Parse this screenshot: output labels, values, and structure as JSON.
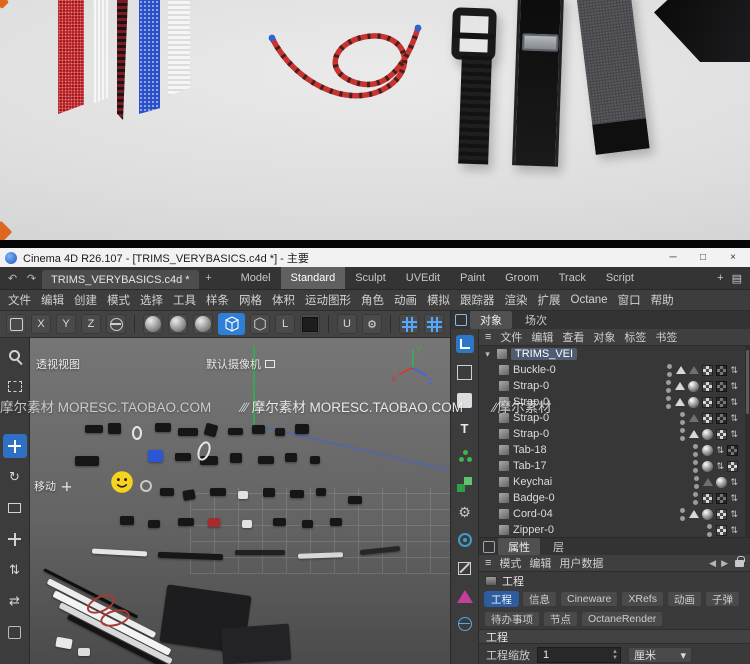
{
  "watermark": {
    "text": "摩尔素材 MORESC.TAOBAO.COM",
    "slashes": "∕∕∕",
    "tail": "∕∕摩尔素材"
  },
  "titlebar": {
    "title": "Cinema 4D R26.107 - [TRIMS_VERYBASICS.c4d *] - 主要",
    "minimize": "─",
    "maximize": "□",
    "close": "×"
  },
  "tabbar": {
    "undo": "↶",
    "redo": "↷",
    "document_tab": "TRIMS_VERYBASICS.c4d *",
    "add_tab": "+",
    "layouts": [
      "Model",
      "Standard",
      "Sculpt",
      "UVEdit",
      "Paint",
      "Groom",
      "Track",
      "Script"
    ],
    "add_layout": "+",
    "layout_menu": "▤"
  },
  "menubar": {
    "items": [
      "文件",
      "编辑",
      "创建",
      "模式",
      "选择",
      "工具",
      "样条",
      "网格",
      "体积",
      "运动图形",
      "角色",
      "动画",
      "模拟",
      "跟踪器",
      "渲染",
      "扩展",
      "Octane",
      "窗口",
      "帮助"
    ]
  },
  "toolbar": {
    "x": "X",
    "y": "Y",
    "z": "Z",
    "l": "L",
    "u": "U"
  },
  "viewport": {
    "view_label": "透视视图",
    "camera_label": "默认摄像机",
    "move_label": "移动",
    "axis_x": "X",
    "axis_y": "Y",
    "axis_z": "Z"
  },
  "object_manager": {
    "tab_object": "对象",
    "tab_takes": "场次",
    "menu": [
      "文件",
      "编辑",
      "查看",
      "对象",
      "标签",
      "书签"
    ],
    "root": "TRIMS_VEI",
    "rows": [
      {
        "name": "Buckle-0"
      },
      {
        "name": "Strap-0"
      },
      {
        "name": "Strap-0"
      },
      {
        "name": "Strap-0"
      },
      {
        "name": "Strap-0"
      },
      {
        "name": "Tab-18"
      },
      {
        "name": "Tab-17"
      },
      {
        "name": "Keychai"
      },
      {
        "name": "Badge-0"
      },
      {
        "name": "Cord-04"
      },
      {
        "name": "Zipper-0"
      }
    ]
  },
  "attributes": {
    "tab_attr": "属性",
    "tab_layer": "层",
    "mode_label": "模式",
    "edit_label": "编辑",
    "userdata_label": "用户数据",
    "object_title": "工程",
    "tabs_row1": [
      "工程",
      "信息",
      "Cineware",
      "XRefs",
      "动画",
      "子弹"
    ],
    "tabs_row2": [
      "待办事项",
      "节点",
      "OctaneRender"
    ],
    "section": "工程",
    "scale_label": "工程缩放",
    "scale_value": "1",
    "scale_unit": "厘米"
  },
  "icons": {
    "updown": "⇅",
    "leftright": "⇄",
    "rotate": "↻",
    "burger": "≡",
    "caret": "▾",
    "tri_down": "▾",
    "left": "◀",
    "right": "▶",
    "gear": "⚙"
  }
}
